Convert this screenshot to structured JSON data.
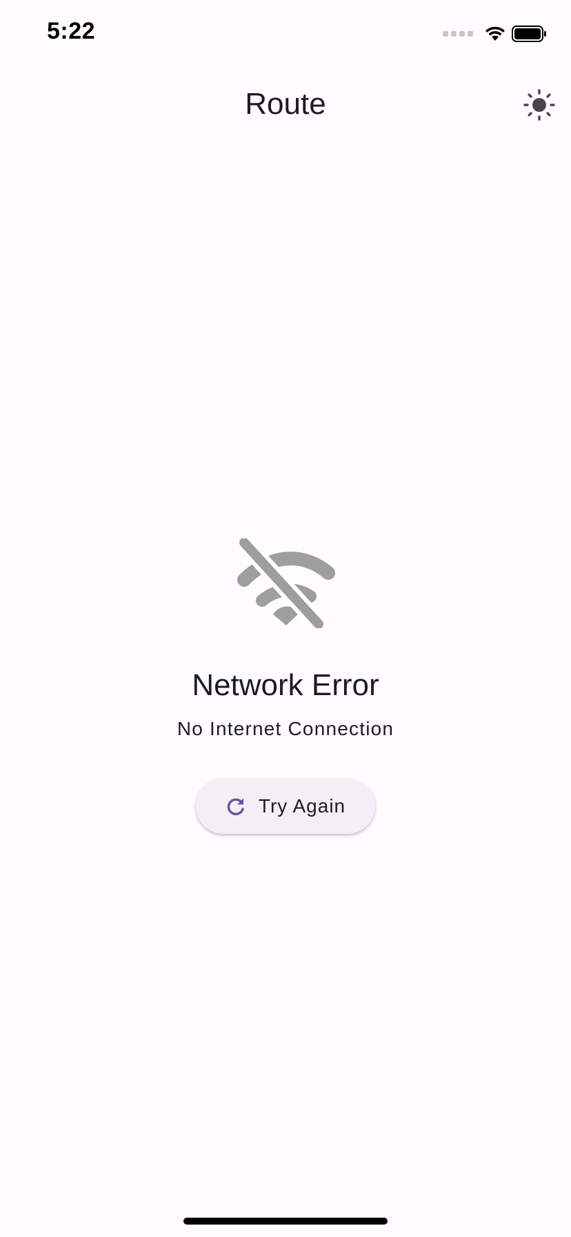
{
  "status_bar": {
    "time": "5:22",
    "icons": [
      "signal-icon",
      "wifi-icon",
      "battery-icon"
    ]
  },
  "app_bar": {
    "title": "Route",
    "theme_toggle_icon": "sun-icon"
  },
  "error": {
    "icon": "wifi-off-icon",
    "title": "Network Error",
    "subtitle": "No Internet Connection",
    "retry_label": "Try Again",
    "retry_icon": "refresh-icon"
  },
  "colors": {
    "background": "#fffbfe",
    "icon_gray": "#9e9e9e",
    "accent": "#6750a4",
    "button_bg": "#f4eff7"
  }
}
